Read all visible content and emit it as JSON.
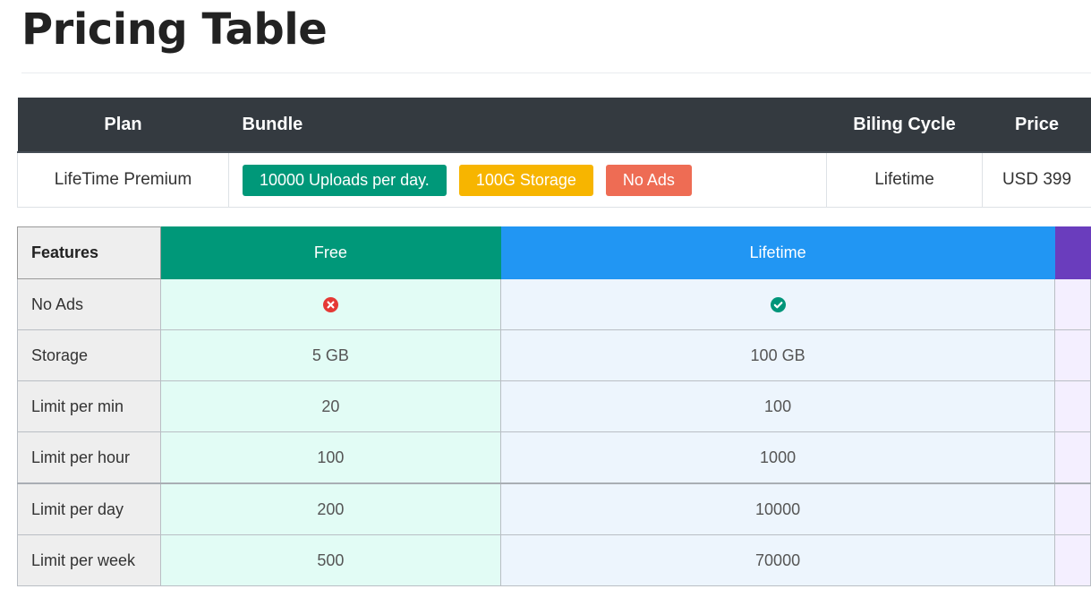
{
  "page": {
    "title": "Pricing Table"
  },
  "plan_table": {
    "headers": {
      "plan": "Plan",
      "bundle": "Bundle",
      "cycle": "Biling Cycle",
      "price": "Price"
    },
    "row": {
      "plan": "LifeTime Premium",
      "badges": [
        {
          "label": "10000 Uploads per day.",
          "color": "#009879"
        },
        {
          "label": "100G Storage",
          "color": "#f7b500"
        },
        {
          "label": "No Ads",
          "color": "#ee6c54"
        }
      ],
      "cycle": "Lifetime",
      "price": "USD 399"
    }
  },
  "features_table": {
    "header_label": "Features",
    "plans": [
      {
        "label": "Free",
        "color": "#009879"
      },
      {
        "label": "Lifetime",
        "color": "#2196f3"
      },
      {
        "label": "",
        "color": "#6a3dbd"
      }
    ],
    "rows": [
      {
        "name": "No Ads",
        "free_icon": "x-circle-icon",
        "lifetime_icon": "check-circle-icon"
      },
      {
        "name": "Storage",
        "free": "5 GB",
        "lifetime": "100 GB"
      },
      {
        "name": "Limit per min",
        "free": "20",
        "lifetime": "100"
      },
      {
        "name": "Limit per hour",
        "free": "100",
        "lifetime": "1000"
      },
      {
        "name": "Limit per day",
        "free": "200",
        "lifetime": "10000"
      },
      {
        "name": "Limit per week",
        "free": "500",
        "lifetime": "70000"
      }
    ],
    "icon_colors": {
      "x": "#e53935",
      "check": "#00957a"
    }
  }
}
